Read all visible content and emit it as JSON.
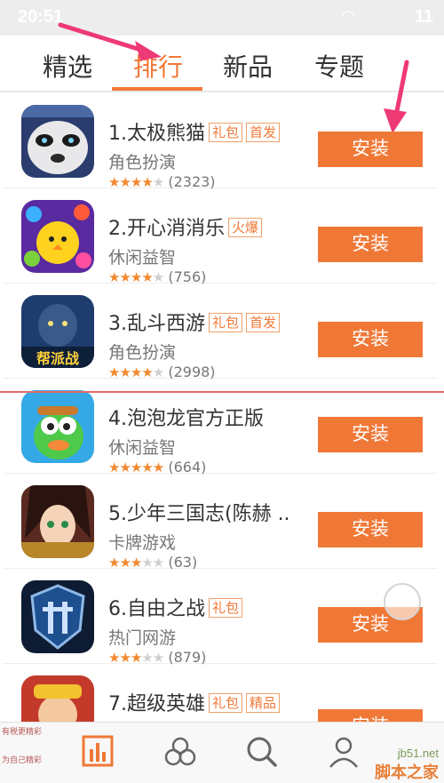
{
  "statusbar": {
    "time": "20:51",
    "right": "11"
  },
  "tabs": [
    {
      "label": "精选"
    },
    {
      "label": "排行"
    },
    {
      "label": "新品"
    },
    {
      "label": "专题"
    }
  ],
  "active_tab": "排行",
  "apps": [
    {
      "rank_name": "1.太极熊猫",
      "badges": [
        "礼包",
        "首发"
      ],
      "category": "角色扮演",
      "stars": 4,
      "reviews": "(2323)",
      "button": "安装"
    },
    {
      "rank_name": "2.开心消消乐",
      "badges": [
        "火爆"
      ],
      "category": "休闲益智",
      "stars": 4,
      "reviews": "(756)",
      "button": "安装"
    },
    {
      "rank_name": "3.乱斗西游",
      "badges": [
        "礼包",
        "首发"
      ],
      "category": "角色扮演",
      "stars": 4,
      "reviews": "(2998)",
      "button": "安装"
    },
    {
      "rank_name": "4.泡泡龙官方正版",
      "badges": [],
      "category": "休闲益智",
      "stars": 5,
      "reviews": "(664)",
      "button": "安装"
    },
    {
      "rank_name": "5.少年三国志(陈赫 ..",
      "badges": [],
      "category": "卡牌游戏",
      "stars": 3,
      "reviews": "(63)",
      "button": "安装"
    },
    {
      "rank_name": "6.自由之战",
      "badges": [
        "礼包"
      ],
      "category": "热门网游",
      "stars": 3,
      "reviews": "(879)",
      "button": "安装"
    },
    {
      "rank_name": "7.超级英雄",
      "badges": [
        "礼包",
        "精品"
      ],
      "category": "",
      "stars": 0,
      "reviews": "",
      "button": "安装"
    }
  ],
  "icon3_text": "帮派战",
  "watermark": {
    "left_lines": [
      "有税更精彩",
      "为自己精彩"
    ],
    "url": "jb51.net",
    "name": "脚本之家"
  },
  "colors": {
    "accent": "#f07836",
    "star": "#f2882f"
  }
}
